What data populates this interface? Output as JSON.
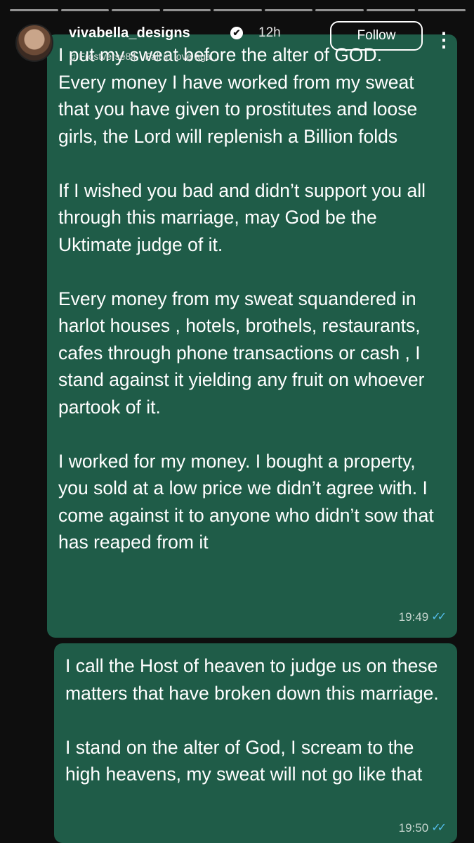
{
  "story": {
    "progress_total": 9,
    "progress_viewed": 9,
    "username": "vivabella_designs",
    "time_ago": "12h",
    "music": "♫ Frostverse84 · Fall in love aga...",
    "follow_label": "Follow",
    "more_icon": "⋮",
    "verified_icon": "✔"
  },
  "messages": [
    {
      "text": "I put my sweat before the alter of GOD.\nEvery money I have worked from my sweat that you have given to prostitutes and loose girls, the Lord will replenish a Billion folds\n\nIf I wished you bad and didn’t support you all through this marriage, may God be the Uktimate judge of it.\n\nEvery money from my sweat squandered in harlot houses , hotels, brothels, restaurants, cafes through phone transactions or cash , I stand against it yielding any fruit on whoever partook of it.\n\nI worked for my money. I bought a property, you sold at a low price we didn’t agree with. I come against it to anyone who didn’t sow that has reaped from it",
      "time": "19:49",
      "ticks": "✓✓"
    },
    {
      "text": "I call the Host of heaven to judge us on these matters that have broken down this marriage.\n\nI stand on the alter of God, I scream to the high heavens, my sweat will not go like that",
      "time": "19:50",
      "ticks": "✓✓"
    }
  ],
  "colors": {
    "bubble": "#1f5c48",
    "background": "#0e0e0e",
    "read_ticks": "#53bdeb"
  }
}
